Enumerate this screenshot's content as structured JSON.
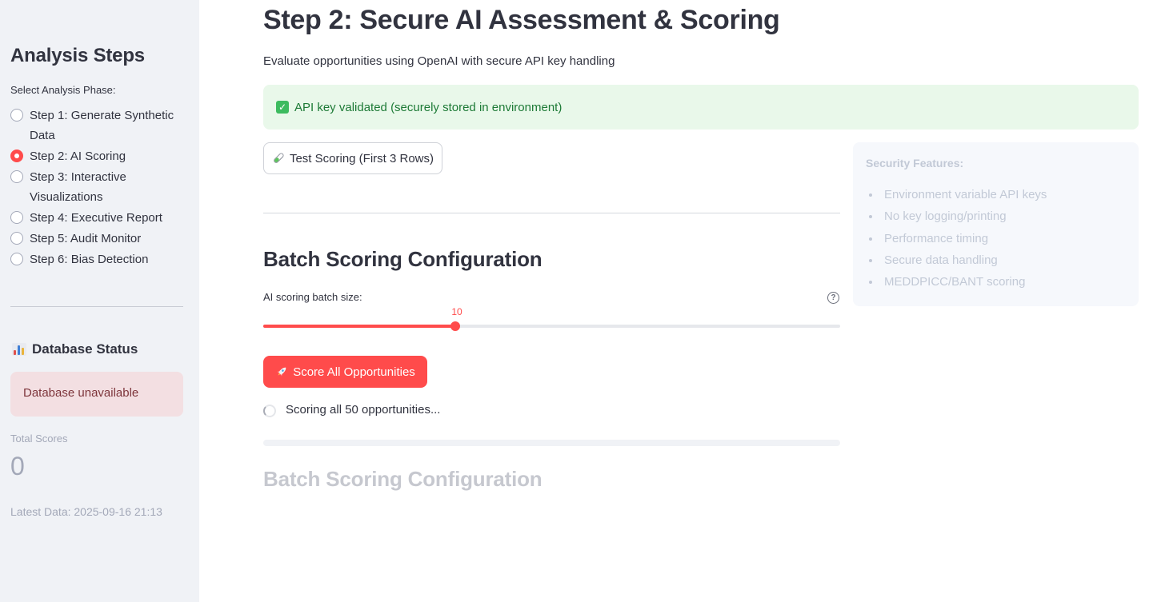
{
  "sidebar": {
    "title": "Analysis Steps",
    "phase_label": "Select Analysis Phase:",
    "steps": [
      {
        "label": "Step 1: Generate Synthetic Data",
        "selected": false
      },
      {
        "label": "Step 2: AI Scoring",
        "selected": true
      },
      {
        "label": "Step 3: Interactive Visualizations",
        "selected": false
      },
      {
        "label": "Step 4: Executive Report",
        "selected": false
      },
      {
        "label": "Step 5: Audit Monitor",
        "selected": false
      },
      {
        "label": "Step 6: Bias Detection",
        "selected": false
      }
    ],
    "db_status": {
      "icon": "bar-chart-icon",
      "title": "Database Status",
      "alert": "Database unavailable",
      "total_scores_label": "Total Scores",
      "total_scores_value": "0",
      "latest_data": "Latest Data: 2025-09-16 21:13"
    }
  },
  "main": {
    "title": "Step 2: Secure AI Assessment & Scoring",
    "subtitle": "Evaluate opportunities using OpenAI with secure API key handling",
    "success_alert": "API key validated (securely stored in environment)",
    "test_button": "Test Scoring (First 3 Rows)",
    "batch_title": "Batch Scoring Configuration",
    "slider": {
      "label": "AI scoring batch size:",
      "value": "10",
      "fraction": 0.333
    },
    "score_button": "Score All Opportunities",
    "spinner_text": "Scoring all 50 opportunities...",
    "progress": 0,
    "faded_batch_title": "Batch Scoring Configuration",
    "security": {
      "title": "Security Features:",
      "items": [
        "Environment variable API keys",
        "No key logging/printing",
        "Performance timing",
        "Secure data handling",
        "MEDDPICC/BANT scoring"
      ]
    }
  },
  "colors": {
    "accent": "#ff4b4b",
    "success_bg": "#e9f8ea",
    "success_text": "#1d7a36",
    "error_bg": "#f3dfe2",
    "error_text": "#7d353b"
  }
}
